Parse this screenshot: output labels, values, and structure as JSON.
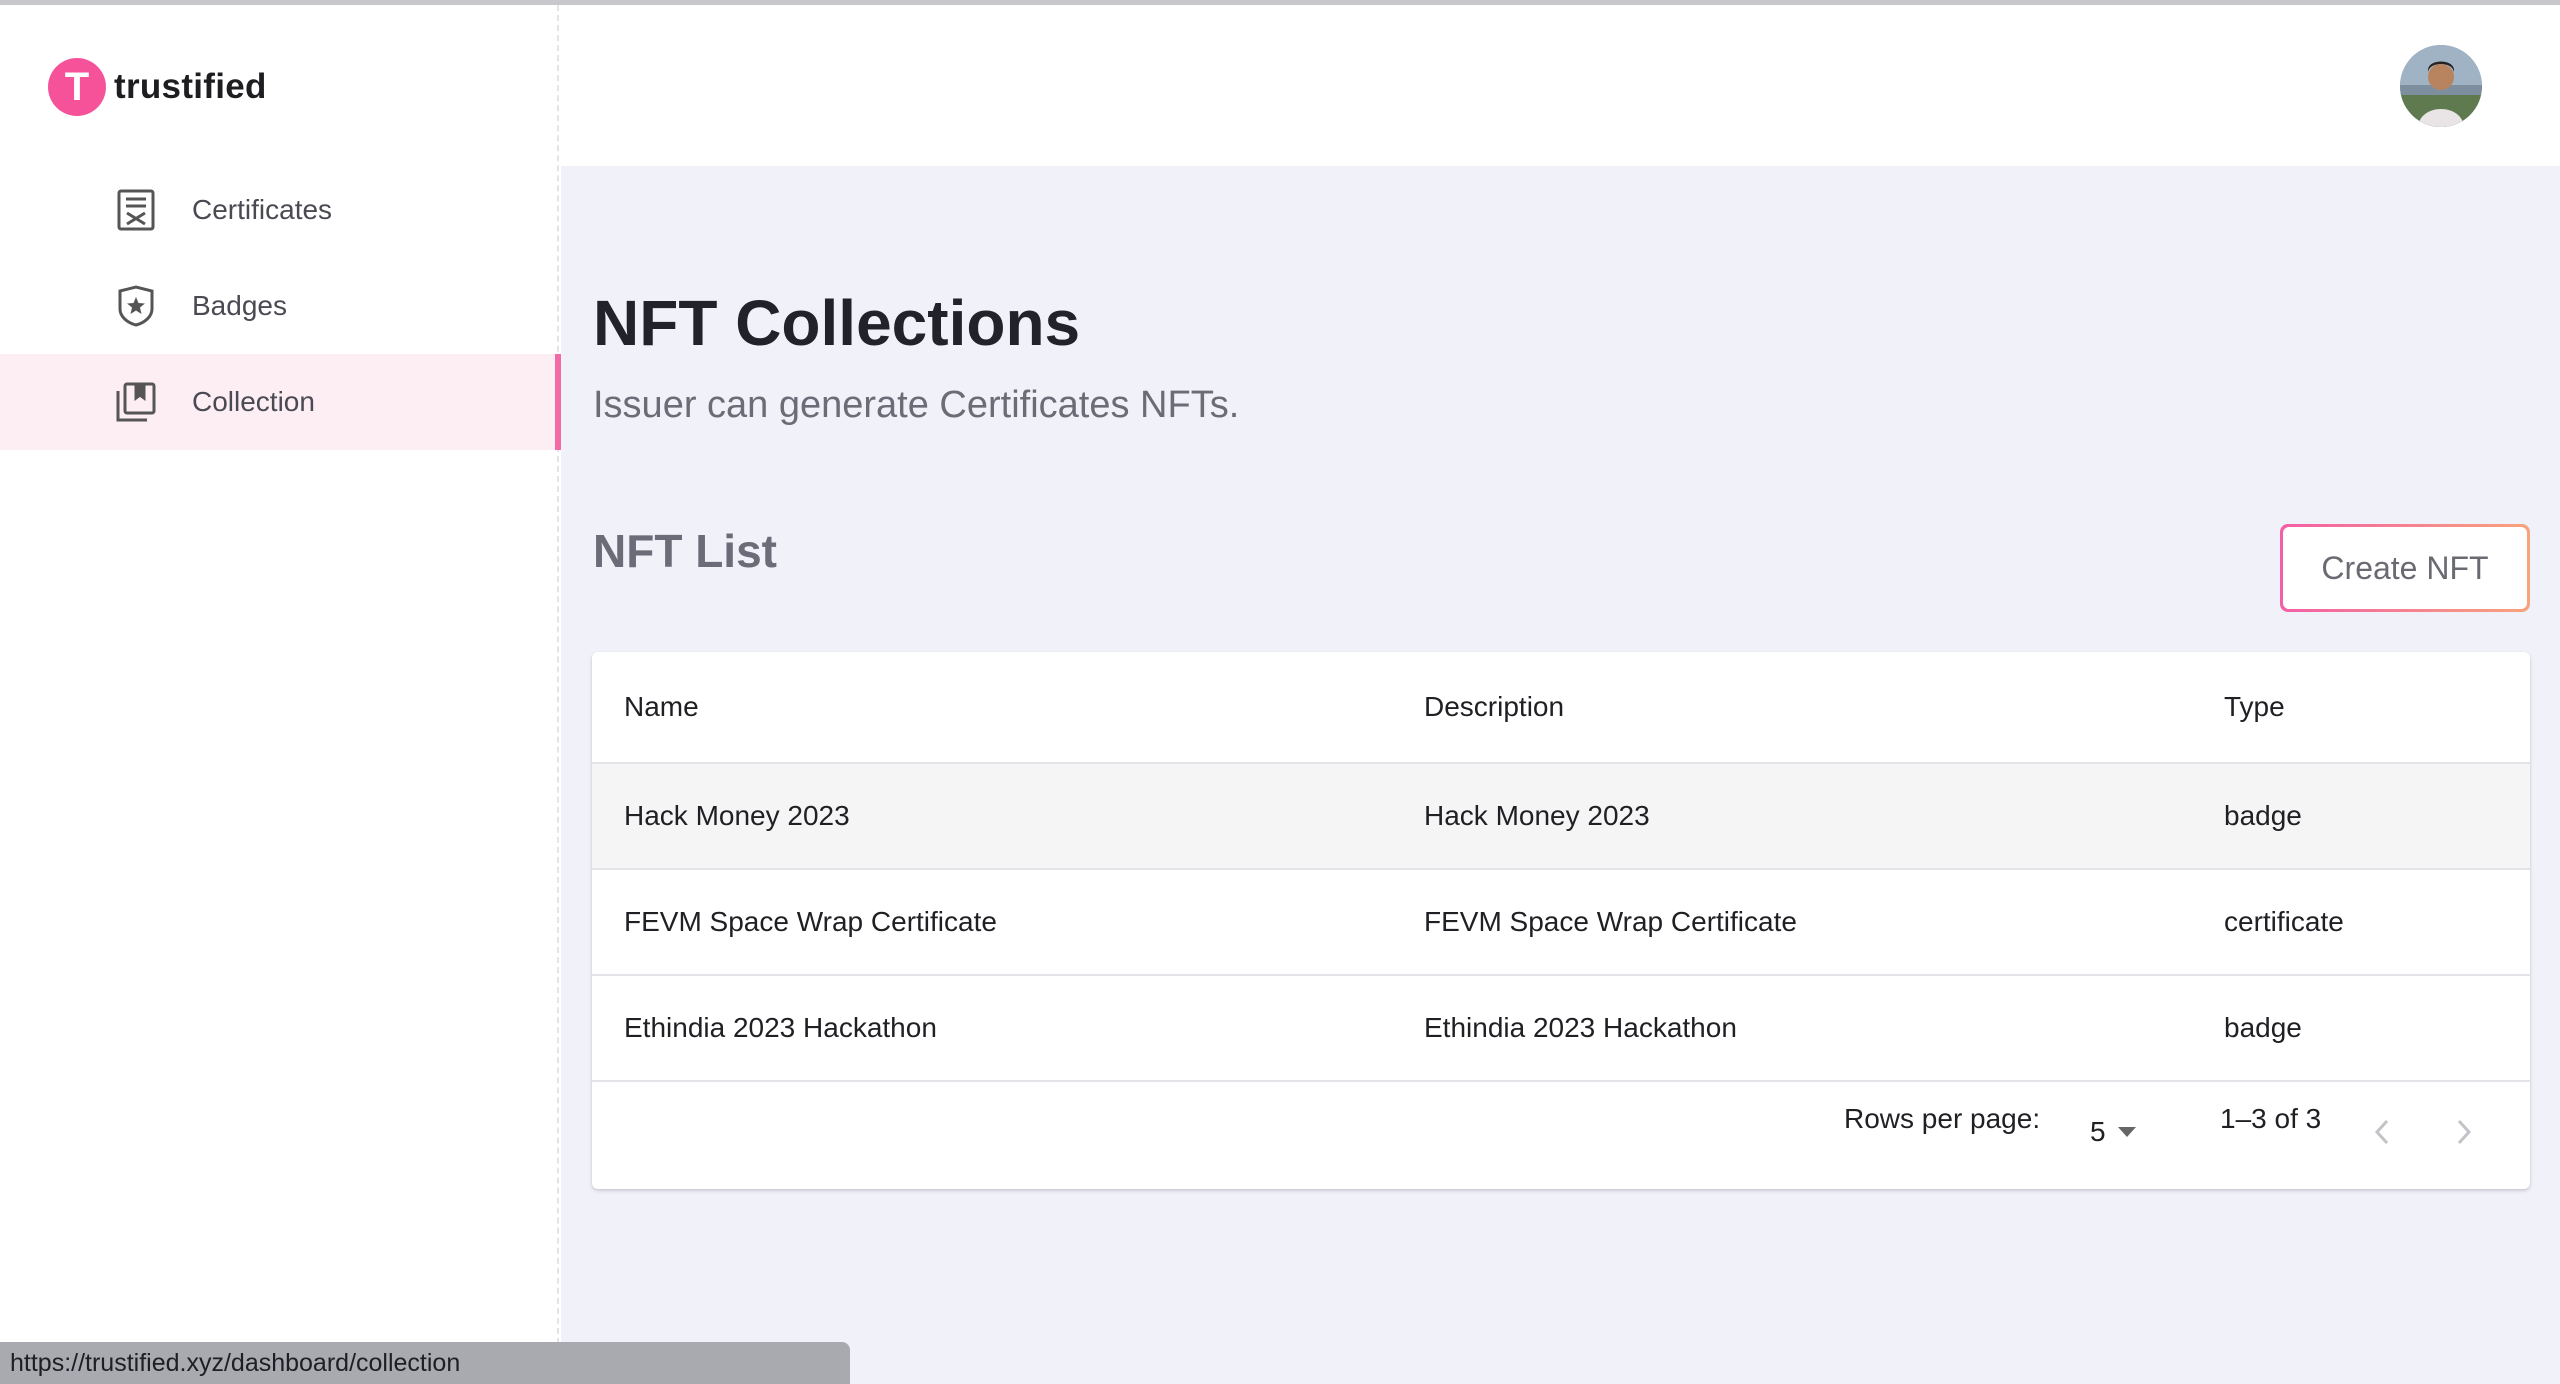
{
  "brand": {
    "logo_letter": "T",
    "name": "trustified",
    "accent": "#f6529a"
  },
  "sidebar": {
    "items": [
      {
        "label": "Certificates",
        "icon": "certificate-icon",
        "active": false
      },
      {
        "label": "Badges",
        "icon": "badge-icon",
        "active": false
      },
      {
        "label": "Collection",
        "icon": "collection-icon",
        "active": true
      }
    ]
  },
  "header": {
    "avatar": "user-avatar"
  },
  "main": {
    "title": "NFT Collections",
    "subtitle": "Issuer can generate Certificates NFTs.",
    "section_title": "NFT List",
    "create_button": "Create NFT"
  },
  "table": {
    "columns": [
      "Name",
      "Description",
      "Type"
    ],
    "rows": [
      {
        "name": "Hack Money 2023",
        "description": "Hack Money 2023",
        "type": "badge"
      },
      {
        "name": "FEVM Space Wrap Certificate",
        "description": "FEVM Space Wrap Certificate",
        "type": "certificate"
      },
      {
        "name": "Ethindia 2023 Hackathon",
        "description": "Ethindia 2023 Hackathon",
        "type": "badge"
      }
    ],
    "pagination": {
      "rows_per_page_label": "Rows per page:",
      "rows_per_page_value": "5",
      "range": "1–3 of 3"
    }
  },
  "status_bar": {
    "url": "https://trustified.xyz/dashboard/collection"
  }
}
